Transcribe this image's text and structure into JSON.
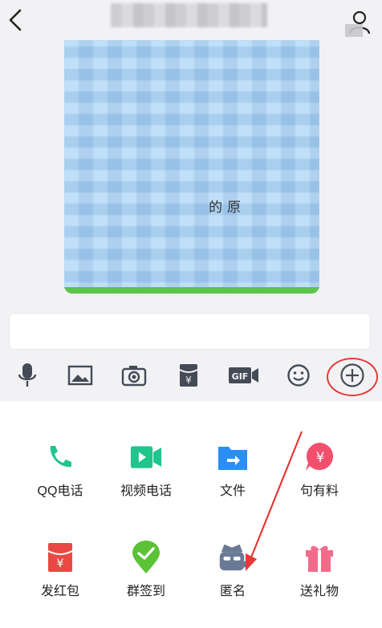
{
  "header": {
    "title": "",
    "back_icon": "chevron-left-icon",
    "profile_icon": "user-icon"
  },
  "chat": {
    "visible_text": "的原"
  },
  "toolbar": {
    "items": [
      {
        "name": "mic-icon"
      },
      {
        "name": "image-icon"
      },
      {
        "name": "camera-icon"
      },
      {
        "name": "red-packet-icon"
      },
      {
        "name": "gif-icon"
      },
      {
        "name": "emoji-icon"
      },
      {
        "name": "plus-icon"
      }
    ],
    "highlight_color": "#e53935"
  },
  "panel": {
    "items": [
      {
        "label": "QQ电话",
        "icon": "phone-icon",
        "color": "#1fc58b"
      },
      {
        "label": "视频电话",
        "icon": "video-icon",
        "color": "#1fc58b"
      },
      {
        "label": "文件",
        "icon": "folder-icon",
        "color": "#2b8ef5"
      },
      {
        "label": "句有料",
        "icon": "yuan-bubble-icon",
        "color": "#f0506e"
      },
      {
        "label": "发红包",
        "icon": "red-envelope-icon",
        "color": "#e84a43"
      },
      {
        "label": "群签到",
        "icon": "check-location-icon",
        "color": "#5bc236"
      },
      {
        "label": "匿名",
        "icon": "anonymous-icon",
        "color": "#6a7a96"
      },
      {
        "label": "送礼物",
        "icon": "gift-icon",
        "color": "#f26b8a"
      }
    ]
  }
}
